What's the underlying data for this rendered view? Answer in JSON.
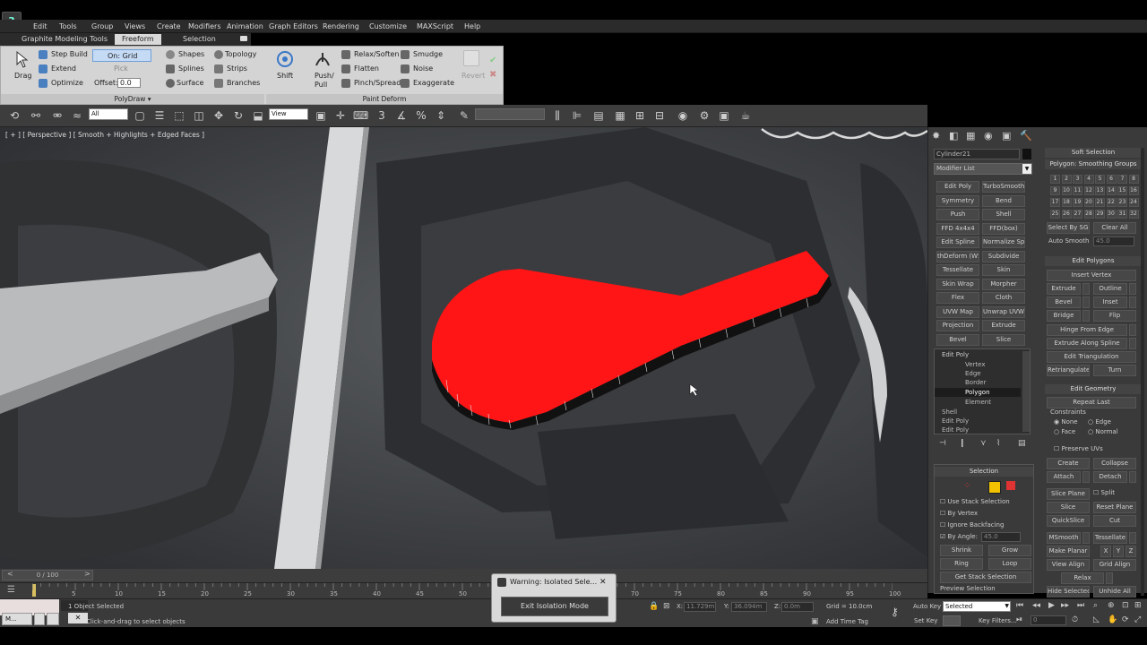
{
  "menubar": {
    "items": [
      "Edit",
      "Tools",
      "Group",
      "Views",
      "Create",
      "Modifiers",
      "Animation",
      "Graph Editors",
      "Rendering",
      "Customize",
      "MAXScript",
      "Help"
    ]
  },
  "ribbon": {
    "tabs": [
      "Graphite Modeling Tools",
      "Freeform",
      "Selection"
    ],
    "polydraw": {
      "drag": "Drag",
      "step_build": "Step Build",
      "extend": "Extend",
      "optimize": "Optimize",
      "on_grid": "On: Grid",
      "pick": "Pick",
      "offset_label": "Offset:",
      "offset_value": "0.0",
      "shapes": "Shapes",
      "splines": "Splines",
      "surface": "Surface",
      "topology": "Topology",
      "strips": "Strips",
      "branches": "Branches",
      "footer": "PolyDraw"
    },
    "shift": "Shift",
    "paint_deform": {
      "push_pull": "Push/\nPull",
      "relax_soften": "Relax/Soften",
      "flatten": "Flatten",
      "pinch_spread": "Pinch/Spread",
      "smudge": "Smudge",
      "noise": "Noise",
      "exaggerate": "Exaggerate",
      "revert": "Revert",
      "footer": "Paint Deform"
    }
  },
  "toolbar": {
    "filter": "All",
    "refcoord": "View"
  },
  "viewport": {
    "label": "[ + ] [ Perspective ] [ Smooth + Highlights + Edged Faces ]"
  },
  "command_panel": {
    "object_name": "Cylinder21",
    "modifier_list": "Modifier List",
    "modifier_buttons": [
      [
        "Edit Poly",
        "TurboSmooth"
      ],
      [
        "Symmetry",
        "Bend"
      ],
      [
        "Push",
        "Shell"
      ],
      [
        "FFD 4x4x4",
        "FFD(box)"
      ],
      [
        "Edit Spline",
        "Normalize Spl."
      ],
      [
        "thDeform (WS",
        "Subdivide"
      ],
      [
        "Tessellate",
        "Skin"
      ],
      [
        "Skin Wrap",
        "Morpher"
      ],
      [
        "Flex",
        "Cloth"
      ],
      [
        "UVW Map",
        "Unwrap UVW"
      ],
      [
        "Projection",
        "Extrude"
      ],
      [
        "Bevel",
        "Slice"
      ]
    ],
    "stack": [
      "Edit Poly",
      "Vertex",
      "Edge",
      "Border",
      "Polygon",
      "Element",
      "Shell",
      "Edit Poly",
      "Edit Poly"
    ],
    "selection": {
      "header": "Selection",
      "use_stack": "Use Stack Selection",
      "by_vertex": "By Vertex",
      "ignore_backfacing": "Ignore Backfacing",
      "by_angle": "By Angle:",
      "by_angle_value": "45.0",
      "shrink": "Shrink",
      "grow": "Grow",
      "ring": "Ring",
      "loop": "Loop",
      "get_stack": "Get Stack Selection",
      "preview": "Preview Selection"
    },
    "soft_selection": "Soft Selection",
    "smoothing_groups": {
      "header": "Polygon: Smoothing Groups",
      "numbers": [
        "1",
        "2",
        "3",
        "4",
        "5",
        "6",
        "7",
        "8",
        "9",
        "10",
        "11",
        "12",
        "13",
        "14",
        "15",
        "16",
        "17",
        "18",
        "19",
        "20",
        "21",
        "22",
        "23",
        "24",
        "25",
        "26",
        "27",
        "28",
        "29",
        "30",
        "31",
        "32"
      ],
      "select_by_sg": "Select By SG",
      "clear_all": "Clear All",
      "auto_smooth": "Auto Smooth",
      "auto_smooth_value": "45.0"
    },
    "edit_polygons": {
      "header": "Edit Polygons",
      "insert_vertex": "Insert Vertex",
      "extrude": "Extrude",
      "outline": "Outline",
      "bevel": "Bevel",
      "inset": "Inset",
      "bridge": "Bridge",
      "flip": "Flip",
      "hinge": "Hinge From Edge",
      "extrude_spline": "Extrude Along Spline",
      "edit_triangulation": "Edit Triangulation",
      "retriangulate": "Retriangulate",
      "turn": "Turn"
    },
    "edit_geometry": {
      "header": "Edit Geometry",
      "repeat_last": "Repeat Last",
      "constraints": "Constraints",
      "none": "None",
      "edge": "Edge",
      "face": "Face",
      "normal": "Normal",
      "preserve_uvs": "Preserve UVs",
      "create": "Create",
      "collapse": "Collapse",
      "attach": "Attach",
      "detach": "Detach",
      "slice_plane": "Slice Plane",
      "split": "Split",
      "slice": "Slice",
      "reset_plane": "Reset Plane",
      "quickslice": "QuickSlice",
      "cut": "Cut",
      "msmooth": "MSmooth",
      "tessellate": "Tessellate",
      "make_planar": "Make Planar",
      "x": "X",
      "y": "Y",
      "z": "Z",
      "view_align": "View Align",
      "grid_align": "Grid Align",
      "relax": "Relax",
      "hide_selected": "Hide Selected",
      "unhide_all": "Unhide All"
    }
  },
  "timeline": {
    "frame": "0 / 100",
    "ticks": [
      "0",
      "5",
      "10",
      "15",
      "20",
      "25",
      "30",
      "35",
      "40",
      "45",
      "50",
      "55",
      "60",
      "65",
      "70",
      "75",
      "80",
      "85",
      "90",
      "95",
      "100"
    ]
  },
  "status": {
    "selected": "1 Object Selected",
    "hint": "Click-and-drag to select objects",
    "x_label": "X:",
    "x_value": "11.729m",
    "y_label": "Y:",
    "y_value": "36.094m",
    "z_label": "Z:",
    "z_value": "0.0m",
    "grid": "Grid = 10.0cm",
    "add_time_tag": "Add Time Tag",
    "auto_key": "Auto Key",
    "set_key": "Set Key",
    "key_mode": "Selected",
    "key_filters": "Key Filters...",
    "frame_value": "0",
    "mini_label": "M..."
  },
  "warning": {
    "title": "Warning: Isolated Sele...",
    "button": "Exit Isolation Mode"
  },
  "colors": {
    "selected_poly": "#ff1515",
    "ui_dark": "#3a3a3a",
    "ribbon_bg": "#d4d4d4",
    "highlight_yellow": "#f2c200"
  }
}
